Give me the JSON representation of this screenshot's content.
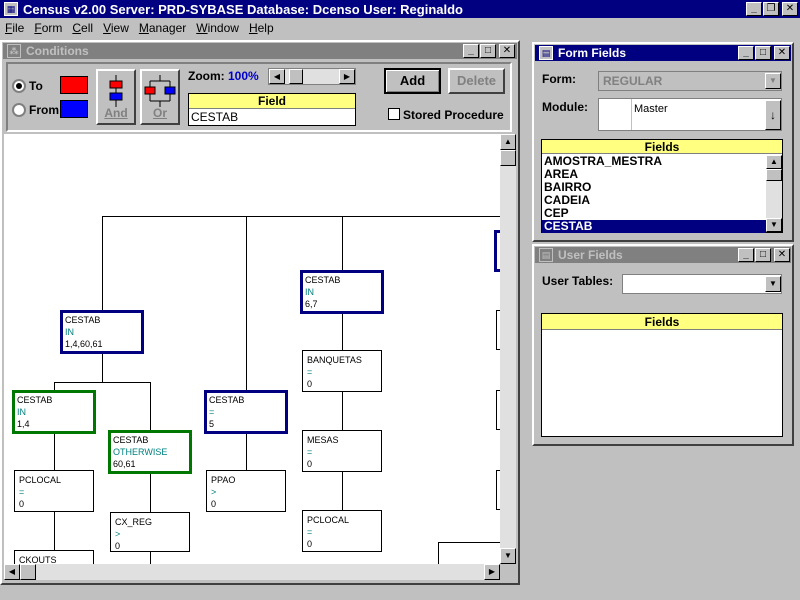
{
  "app": {
    "title": "Census v2.00   Server: PRD-SYBASE   Database: Dcenso   User: Reginaldo",
    "menu": [
      "File",
      "Form",
      "Cell",
      "View",
      "Manager",
      "Window",
      "Help"
    ]
  },
  "conditions": {
    "title": "Conditions",
    "to_label": "To",
    "from_label": "From",
    "to_color": "#ff0000",
    "from_color": "#0000ff",
    "and_label": "And",
    "or_label": "Or",
    "zoom_label": "Zoom:",
    "zoom_value": "100%",
    "field_header": "Field",
    "field_value": "CESTAB",
    "add_label": "Add",
    "delete_label": "Delete",
    "stored_procedure_label": "Stored Procedure"
  },
  "tree": {
    "n1": {
      "name": "CESTAB",
      "op": "IN",
      "val": "1,4,60,61"
    },
    "n2": {
      "name": "CESTAB",
      "op": "IN",
      "val": "6,7"
    },
    "n3": {
      "name": "BANQUETAS",
      "op": "=",
      "val": "0"
    },
    "n4": {
      "name": "CESTAB",
      "op": "IN",
      "val": "1,4"
    },
    "n5": {
      "name": "CESTAB",
      "op": "OTHERWISE",
      "val": "60,61"
    },
    "n6": {
      "name": "CESTAB",
      "op": "=",
      "val": "5"
    },
    "n7": {
      "name": "MESAS",
      "op": "=",
      "val": "0"
    },
    "n8": {
      "name": "PCLOCAL",
      "op": "=",
      "val": "0"
    },
    "n9": {
      "name": "PPAO",
      "op": ">",
      "val": "0"
    },
    "n10": {
      "name": "CX_REG",
      "op": ">",
      "val": "0"
    },
    "n11": {
      "name": "PCLOCAL",
      "op": "=",
      "val": "0"
    },
    "n12": {
      "name": "CKOUTS",
      "op": "",
      "val": ""
    }
  },
  "form_fields": {
    "title": "Form Fields",
    "form_label": "Form:",
    "form_value": "REGULAR",
    "module_label": "Module:",
    "module_value": "Master",
    "fields_header": "Fields",
    "fields": [
      "AMOSTRA_MESTRA",
      "AREA",
      "BAIRRO",
      "CADEIA",
      "CEP",
      "CESTAB"
    ],
    "selected": "CESTAB"
  },
  "user_fields": {
    "title": "User Fields",
    "tables_label": "User Tables:",
    "fields_header": "Fields"
  }
}
